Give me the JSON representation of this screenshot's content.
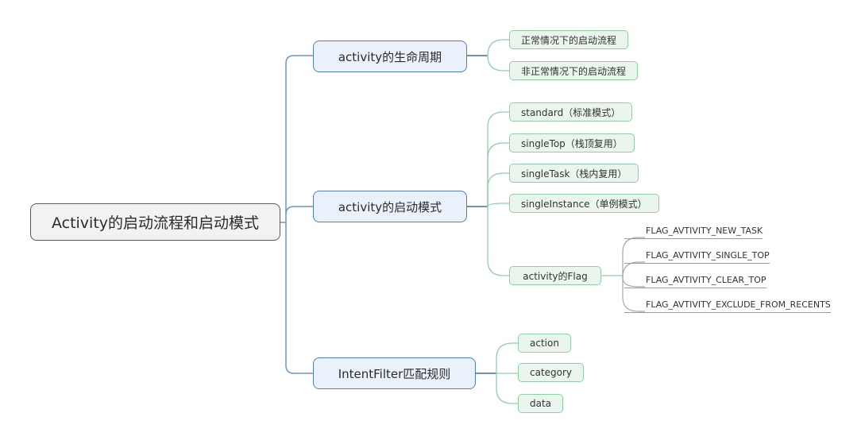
{
  "root": {
    "label": "Activity的启动流程和启动模式"
  },
  "branches": [
    {
      "label": "activity的生命周期",
      "children": [
        {
          "label": "正常情况下的启动流程"
        },
        {
          "label": "非正常情况下的启动流程"
        }
      ]
    },
    {
      "label": "activity的启动模式",
      "children": [
        {
          "label": "standard（标准模式）"
        },
        {
          "label": "singleTop（栈顶复用）"
        },
        {
          "label": "singleTask（栈内复用）"
        },
        {
          "label": "singleInstance（单例模式）"
        },
        {
          "label": "activity的Flag",
          "children": [
            {
              "label": "FLAG_AVTIVITY_NEW_TASK"
            },
            {
              "label": "FLAG_AVTIVITY_SINGLE_TOP"
            },
            {
              "label": "FLAG_AVTIVITY_CLEAR_TOP"
            },
            {
              "label": "FLAG_AVTIVITY_EXCLUDE_FROM_RECENTS"
            }
          ]
        }
      ]
    },
    {
      "label": "IntentFilter匹配规则",
      "children": [
        {
          "label": "action"
        },
        {
          "label": "category"
        },
        {
          "label": "data"
        }
      ]
    }
  ],
  "colors": {
    "root_border": "#595959",
    "main_border": "#4f7fbf",
    "main_fill": "#eaf1fb",
    "sub_border": "#8fcfa3",
    "sub_fill": "#eaf6ed",
    "leaf_line": "#9a9a9a"
  }
}
